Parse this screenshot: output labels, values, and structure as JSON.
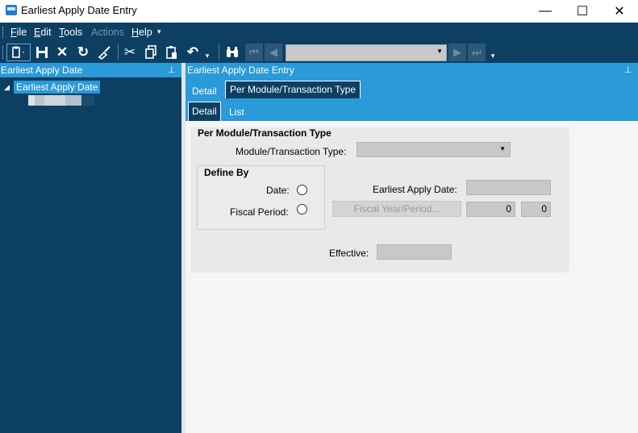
{
  "window": {
    "title": "Earliest Apply Date Entry",
    "controls": {
      "minimize": "—",
      "maximize": "☐",
      "close": "✕"
    }
  },
  "menu": {
    "items": [
      {
        "label": "File",
        "mnemonic": "F",
        "rest": "ile"
      },
      {
        "label": "Edit",
        "mnemonic": "E",
        "rest": "dit"
      },
      {
        "label": "Tools",
        "mnemonic": "T",
        "rest": "ools"
      },
      {
        "label": "Actions",
        "disabled": true
      },
      {
        "label": "Help",
        "mnemonic": "H",
        "rest": "elp"
      }
    ]
  },
  "toolbar": {
    "icons": [
      "new-icon",
      "save-icon",
      "delete-icon",
      "refresh-icon",
      "clear-icon",
      "cut-icon",
      "copy-icon",
      "paste-icon",
      "undo-icon",
      "find-icon",
      "first-record-icon",
      "previous-record-icon",
      "next-record-icon",
      "last-record-icon"
    ],
    "navigator_value": ""
  },
  "left_panel": {
    "title": "Earliest Apply Date",
    "tree": {
      "root_label": "Earliest Apply Date",
      "expanded": true
    }
  },
  "right_panel": {
    "title": "Earliest Apply Date Entry",
    "top_tabs": [
      {
        "label": "Detail",
        "active": false
      },
      {
        "label": "Per Module/Transaction Type",
        "active": true
      }
    ],
    "sub_tabs": [
      {
        "label": "Detail",
        "active": true
      },
      {
        "label": "List",
        "active": false
      }
    ]
  },
  "form": {
    "section_title": "Per Module/Transaction Type",
    "module_label": "Module/Transaction Type:",
    "module_value": "",
    "define_by": {
      "title": "Define By",
      "date_label": "Date:",
      "fiscal_label": "Fiscal Period:",
      "selected": null
    },
    "earliest_apply_label": "Earliest Apply Date:",
    "earliest_apply_value": "",
    "fiscal_button_label": "Fiscal Year/Period...",
    "fiscal_year": "0",
    "fiscal_period": "0",
    "effective_label": "Effective:",
    "effective_value": ""
  },
  "colors": {
    "chrome_dark": "#0d3f63",
    "accent_blue": "#2a9ad8",
    "panel_gray": "#e9e9e9",
    "field_gray": "#c8c8c8"
  }
}
